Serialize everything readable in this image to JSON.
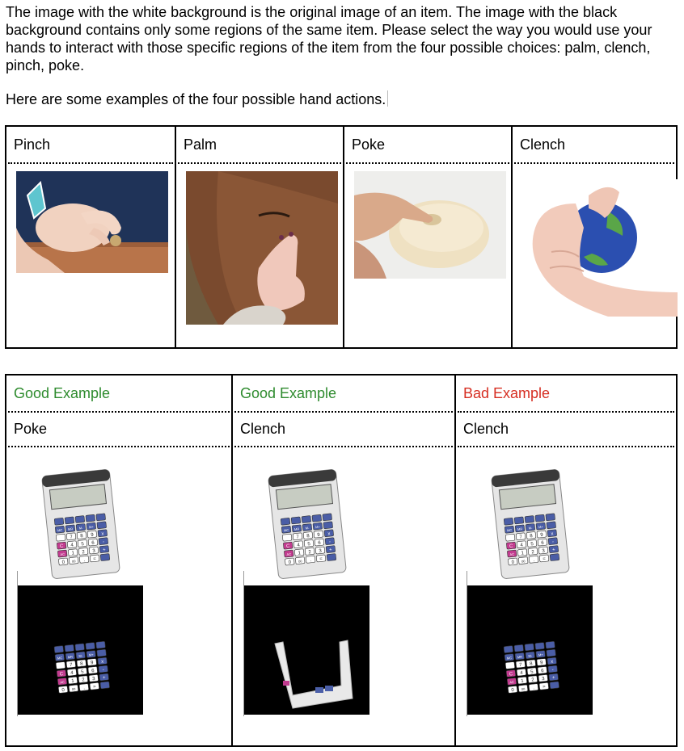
{
  "intro": {
    "paragraph": "The image with the white background is the original image of an item. The image with the black background contains only some regions of the same item. Please select the way you would use your hands to interact with those specific regions of the item from the four possible choices: palm, clench, pinch, poke.",
    "examples_line": "Here are some examples of the four possible hand actions."
  },
  "actions_table": {
    "headers": [
      "Pinch",
      "Palm",
      "Poke",
      "Clench"
    ]
  },
  "examples_table": {
    "columns": [
      {
        "quality": "Good Example",
        "action": "Poke"
      },
      {
        "quality": "Good Example",
        "action": "Clench"
      },
      {
        "quality": "Bad Example",
        "action": "Clench"
      }
    ]
  },
  "colors": {
    "good": "#2e8b2e",
    "bad": "#d62e22",
    "border": "#000000"
  },
  "calculator_keys": {
    "row1": [
      "",
      "",
      "",
      "",
      ""
    ],
    "row2": [
      "MC",
      "MR",
      "M-",
      "M+",
      ""
    ],
    "row3": [
      "",
      "7",
      "8",
      "9",
      "x"
    ],
    "row4": [
      "C",
      "4",
      "5",
      "6",
      "-"
    ],
    "row5": [
      "AC",
      "1",
      "2",
      "3",
      "+"
    ],
    "row6": [
      "0",
      "00",
      ".",
      "=",
      ""
    ]
  }
}
